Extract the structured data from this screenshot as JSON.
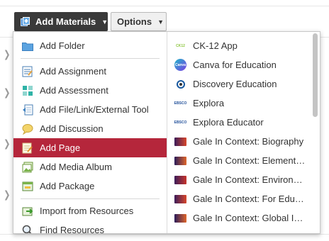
{
  "toolbar": {
    "add_materials_label": "Add Materials",
    "options_label": "Options"
  },
  "menu": {
    "items": [
      {
        "label": "Add Folder",
        "icon": "folder-icon"
      },
      {
        "label": "Add Assignment",
        "icon": "assignment-icon"
      },
      {
        "label": "Add Assessment",
        "icon": "assessment-icon"
      },
      {
        "label": "Add File/Link/External Tool",
        "icon": "file-link-icon"
      },
      {
        "label": "Add Discussion",
        "icon": "discussion-icon"
      },
      {
        "label": "Add Page",
        "icon": "page-icon"
      },
      {
        "label": "Add Media Album",
        "icon": "media-album-icon"
      },
      {
        "label": "Add Package",
        "icon": "package-icon"
      },
      {
        "label": "Import from Resources",
        "icon": "import-icon"
      },
      {
        "label": "Find Resources",
        "icon": "magnifier-icon"
      }
    ],
    "active_item": "Add Page"
  },
  "apps": {
    "items": [
      {
        "label": "CK-12 App",
        "logo_text": "CK12"
      },
      {
        "label": "Canva for Education",
        "logo_text": "Canva"
      },
      {
        "label": "Discovery Education",
        "logo_text": ""
      },
      {
        "label": "Explora",
        "logo_text": "EBSCO"
      },
      {
        "label": "Explora Educator",
        "logo_text": "EBSCO"
      },
      {
        "label": "Gale In Context: Biography",
        "logo_text": ""
      },
      {
        "label": "Gale In Context: Element…",
        "logo_text": ""
      },
      {
        "label": "Gale In Context: Environ…",
        "logo_text": ""
      },
      {
        "label": "Gale In Context: For Educ…",
        "logo_text": ""
      },
      {
        "label": "Gale In Context: Global Is…",
        "logo_text": ""
      }
    ]
  },
  "colors": {
    "active_bg": "#b5263b",
    "toolbar_dark": "#3a3a3a"
  }
}
